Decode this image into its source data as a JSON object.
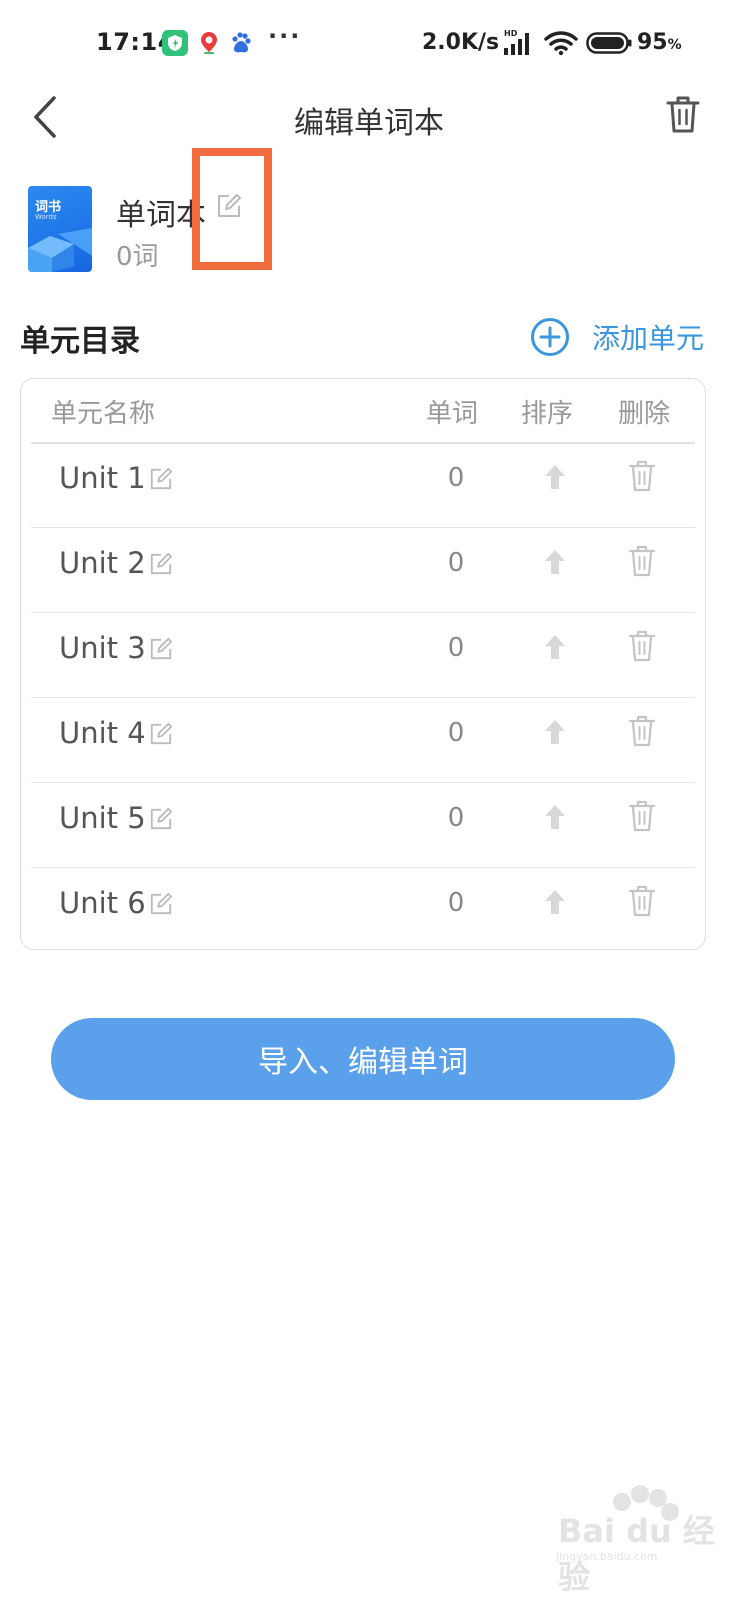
{
  "status_bar": {
    "time": "17:14",
    "more": "···",
    "net_speed": "2.0K/s",
    "battery": "95",
    "battery_unit": "%",
    "icons": [
      "shield-app-icon",
      "map-pin-app-icon",
      "baidu-app-icon",
      "signal-hd-icon",
      "wifi-icon",
      "battery-icon"
    ]
  },
  "header": {
    "title": "编辑单词本",
    "back_icon": "chevron-left-icon",
    "delete_icon": "trash-icon"
  },
  "book": {
    "cover_title": "词书",
    "cover_subtitle": "Words",
    "name": "单词本",
    "count": "0词",
    "edit_icon": "edit-icon"
  },
  "section": {
    "title": "单元目录",
    "add_label": "添加单元",
    "add_icon": "plus-circle-icon"
  },
  "table": {
    "headers": {
      "name": "单元名称",
      "words": "单词",
      "sort": "排序",
      "delete": "删除"
    },
    "rows": [
      {
        "name": "Unit 1",
        "count": "0"
      },
      {
        "name": "Unit 2",
        "count": "0"
      },
      {
        "name": "Unit 3",
        "count": "0"
      },
      {
        "name": "Unit 4",
        "count": "0"
      },
      {
        "name": "Unit 5",
        "count": "0"
      },
      {
        "name": "Unit 6",
        "count": "0"
      }
    ]
  },
  "primary_button": {
    "label": "导入、编辑单词"
  },
  "watermark": {
    "text": "Bai du 经验",
    "url": "jingyan.baidu.com"
  },
  "colors": {
    "accent": "#3a96dd",
    "button": "#5aa0ea",
    "highlight": "#f26d3d",
    "cover": "#1f74e6"
  }
}
